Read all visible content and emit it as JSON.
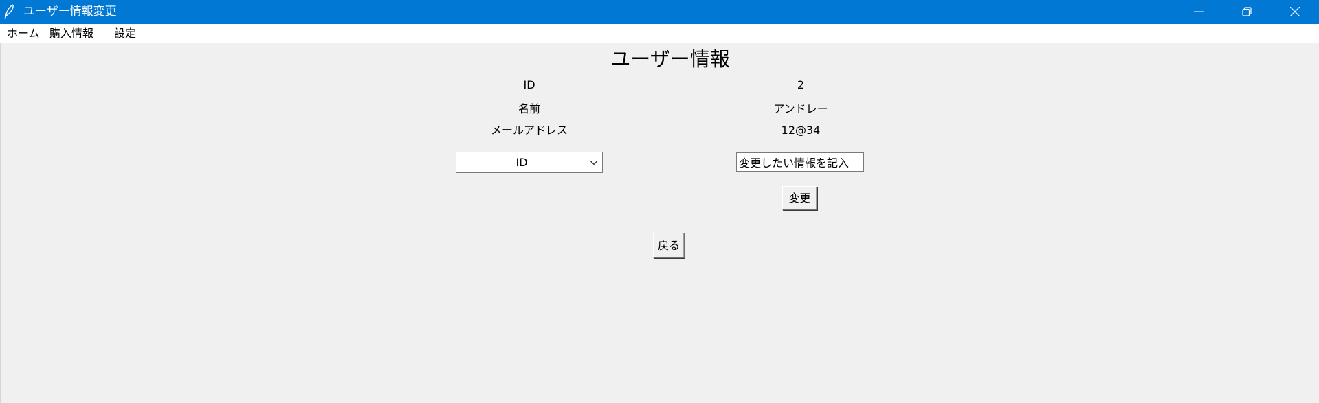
{
  "window": {
    "title": "ユーザー情報変更",
    "titlebar_color": "#0078d4",
    "icons": {
      "app": "feather-icon",
      "minimize": "minimize-icon",
      "restore": "restore-icon",
      "close": "close-icon"
    }
  },
  "menu": {
    "items": [
      "ホーム",
      "購入情報",
      "設定"
    ]
  },
  "main": {
    "heading": "ユーザー情報",
    "fields": [
      {
        "label": "ID",
        "value": "2"
      },
      {
        "label": "名前",
        "value": "アンドレー"
      },
      {
        "label": "メールアドレス",
        "value": "12@34"
      }
    ],
    "select": {
      "value": "ID",
      "icon": "chevron-down-icon"
    },
    "input": {
      "value": "変更したい情報を記入"
    },
    "change_button": "変更",
    "back_button": "戻る"
  }
}
